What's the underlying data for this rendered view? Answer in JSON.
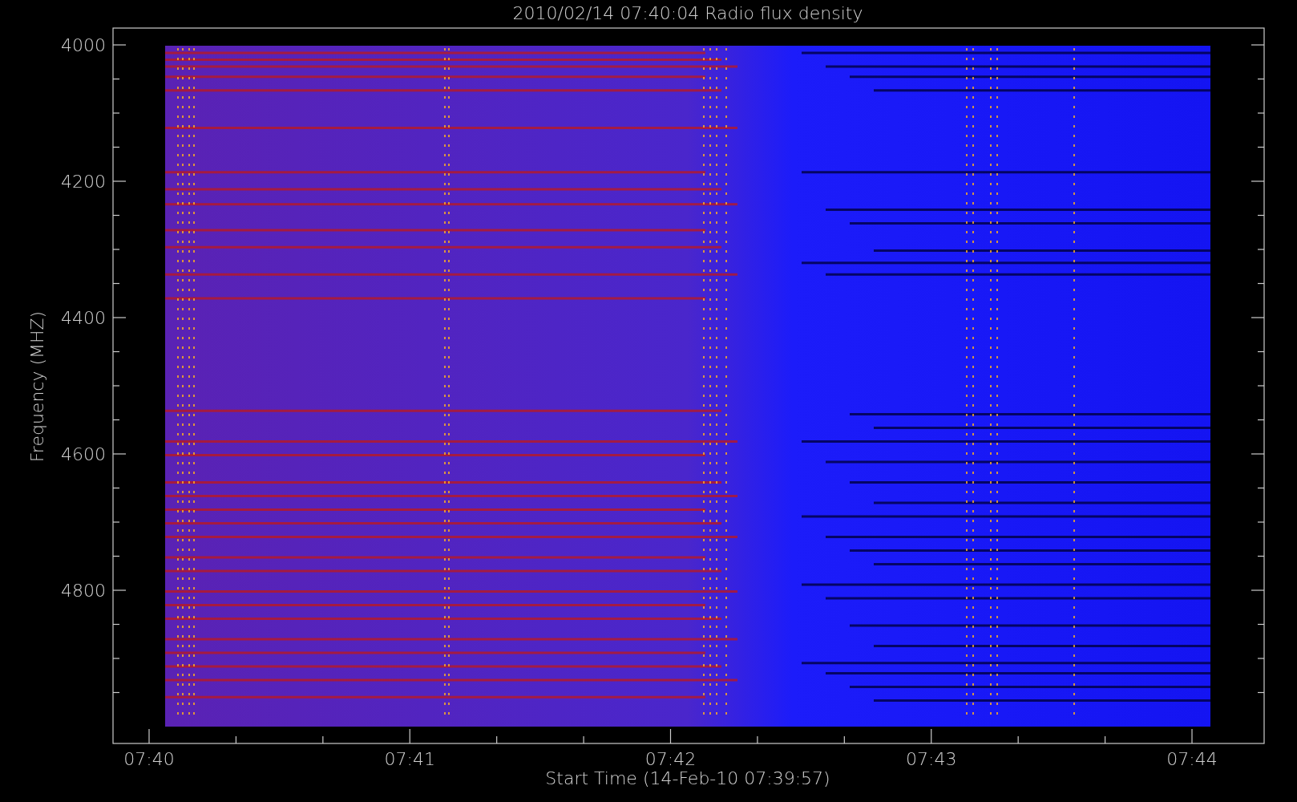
{
  "plot": {
    "title": "2010/02/14 07:40:04 Radio flux density",
    "ylabel": "Frequency (MHZ)",
    "xlabel": "Start Time (14-Feb-10 07:39:57)",
    "yticks": [
      "4000",
      "4200",
      "4400",
      "4600",
      "4800"
    ],
    "xticks": [
      "07:40",
      "07:41",
      "07:42",
      "07:43",
      "07:44"
    ]
  }
}
